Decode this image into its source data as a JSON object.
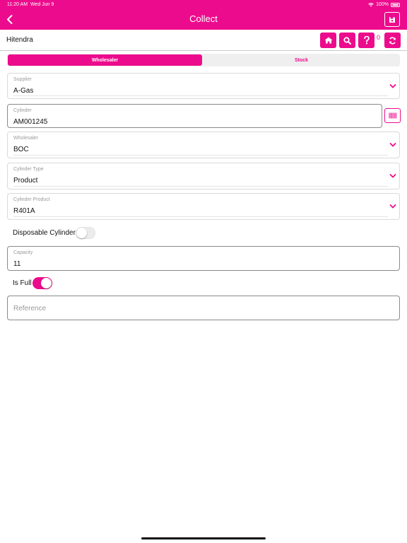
{
  "status_bar": {
    "time": "11:20 AM",
    "date": "Wed Jun 9",
    "battery": "100%"
  },
  "header": {
    "title": "Collect"
  },
  "user": {
    "name": "Hitendra",
    "notification_count": "0"
  },
  "tabs": [
    {
      "label": "Wholesaler",
      "active": true
    },
    {
      "label": "Stock",
      "active": false
    }
  ],
  "form": {
    "supplier": {
      "label": "Supplier",
      "value": "A-Gas"
    },
    "cylinder": {
      "label": "Cylinder",
      "value": "AM001245"
    },
    "wholesaler": {
      "label": "Wholesaler",
      "value": "BOC"
    },
    "cylinder_type": {
      "label": "Cylinder Type",
      "value": "Product"
    },
    "cylinder_product": {
      "label": "Cylinder Product",
      "value": "R401A"
    },
    "disposable_cylinder": {
      "label": "Disposable Cylinder",
      "on": false
    },
    "capacity": {
      "label": "Capacity",
      "value": "11"
    },
    "is_full": {
      "label": "Is Full",
      "on": true
    },
    "reference": {
      "placeholder": "Reference",
      "value": ""
    }
  },
  "colors": {
    "accent": "#ec0b8c",
    "toggle_off": "#ececec",
    "label_gray": "#9a9a9a"
  },
  "icons": {
    "back": "chevron-left-icon",
    "save": "save-icon",
    "home": "home-icon",
    "search": "search-icon",
    "help": "question-icon",
    "sync": "sync-icon",
    "barcode": "barcode-icon",
    "dropdown": "chevron-down-icon"
  }
}
